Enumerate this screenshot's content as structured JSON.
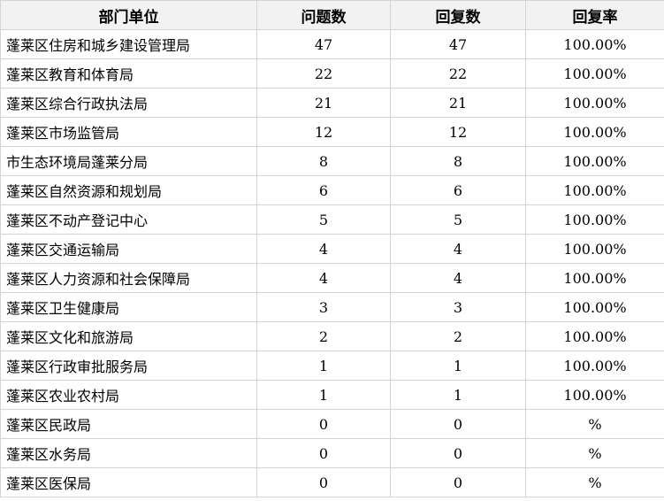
{
  "table": {
    "headers": [
      "部门单位",
      "问题数",
      "回复数",
      "回复率"
    ],
    "rows": [
      {
        "unit": "蓬莱区住房和城乡建设管理局",
        "questions": "47",
        "replies": "47",
        "rate": "100.00%"
      },
      {
        "unit": "蓬莱区教育和体育局",
        "questions": "22",
        "replies": "22",
        "rate": "100.00%"
      },
      {
        "unit": "蓬莱区综合行政执法局",
        "questions": "21",
        "replies": "21",
        "rate": "100.00%"
      },
      {
        "unit": "蓬莱区市场监管局",
        "questions": "12",
        "replies": "12",
        "rate": "100.00%"
      },
      {
        "unit": "市生态环境局蓬莱分局",
        "questions": "8",
        "replies": "8",
        "rate": "100.00%"
      },
      {
        "unit": "蓬莱区自然资源和规划局",
        "questions": "6",
        "replies": "6",
        "rate": "100.00%"
      },
      {
        "unit": "蓬莱区不动产登记中心",
        "questions": "5",
        "replies": "5",
        "rate": "100.00%"
      },
      {
        "unit": "蓬莱区交通运输局",
        "questions": "4",
        "replies": "4",
        "rate": "100.00%"
      },
      {
        "unit": "蓬莱区人力资源和社会保障局",
        "questions": "4",
        "replies": "4",
        "rate": "100.00%"
      },
      {
        "unit": "蓬莱区卫生健康局",
        "questions": "3",
        "replies": "3",
        "rate": "100.00%"
      },
      {
        "unit": "蓬莱区文化和旅游局",
        "questions": "2",
        "replies": "2",
        "rate": "100.00%"
      },
      {
        "unit": "蓬莱区行政审批服务局",
        "questions": "1",
        "replies": "1",
        "rate": "100.00%"
      },
      {
        "unit": "蓬莱区农业农村局",
        "questions": "1",
        "replies": "1",
        "rate": "100.00%"
      },
      {
        "unit": "蓬莱区民政局",
        "questions": "0",
        "replies": "0",
        "rate": "%"
      },
      {
        "unit": "蓬莱区水务局",
        "questions": "0",
        "replies": "0",
        "rate": "%"
      },
      {
        "unit": "蓬莱区医保局",
        "questions": "0",
        "replies": "0",
        "rate": "%"
      }
    ]
  }
}
